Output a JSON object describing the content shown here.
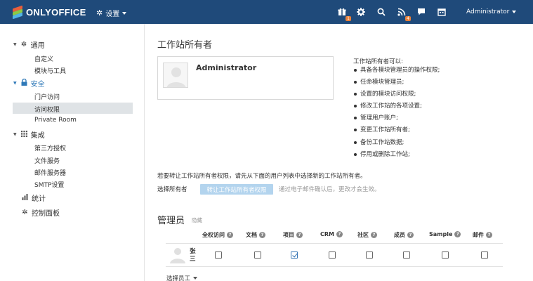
{
  "header": {
    "logo_text": "ONLYOFFICE",
    "settings_label": "设置",
    "user_name": "Administrator",
    "notifications": {
      "gift_badge": "1",
      "feed_badge": "4"
    },
    "icons": [
      "gift-icon",
      "gear-icon",
      "search-icon",
      "feed-icon",
      "chat-icon",
      "calendar-icon"
    ]
  },
  "sidebar": {
    "groups": [
      {
        "label": "通用",
        "icon": "gear-icon",
        "items": [
          "自定义",
          "模块与工具"
        ]
      },
      {
        "label": "安全",
        "icon": "lock-icon",
        "items": [
          "门户访问",
          "访问权限",
          "Private Room"
        ]
      },
      {
        "label": "集成",
        "icon": "grid-icon",
        "items": [
          "第三方授权",
          "文件服务",
          "邮件服务器",
          "SMTP设置"
        ]
      },
      {
        "label": "统计",
        "icon": "bar-chart-icon",
        "items": []
      },
      {
        "label": "控制面板",
        "icon": "cog-icon",
        "items": []
      }
    ],
    "selected_item": "访问权限"
  },
  "owner": {
    "title": "工作站所有者",
    "name": "Administrator",
    "rights_title": "工作站所有者可以:",
    "rights": [
      "具备各模块管理员的操作权限;",
      "任命模块管理员;",
      "设置的模块访问权限;",
      "修改工作站的各项设置;",
      "管理用户账户;",
      "变更工作站所有者;",
      "备份工作站数据;",
      "停用或删除工作站;"
    ],
    "transfer_desc": "若要转让工作站所有者权限，请先从下面的用户列表中选择新的工作站所有者。",
    "transfer_label": "选择所有者",
    "transfer_button": "转让工作站所有者权限",
    "transfer_hint": "通过电子邮件确认后，更改才会生效。"
  },
  "admins": {
    "title": "管理员",
    "hide_label": "隐藏",
    "columns": [
      "全权访问",
      "文档",
      "项目",
      "CRM",
      "社区",
      "成员",
      "Sample",
      "邮件"
    ],
    "rows": [
      {
        "name": "张三",
        "checked": [
          false,
          false,
          true,
          false,
          false,
          false,
          false,
          false
        ]
      }
    ],
    "select_users_label": "选择员工"
  },
  "colors": {
    "header_bg": "#1f4a7a",
    "accent": "#2f79b8",
    "button_disabled": "#b3d4ee"
  }
}
